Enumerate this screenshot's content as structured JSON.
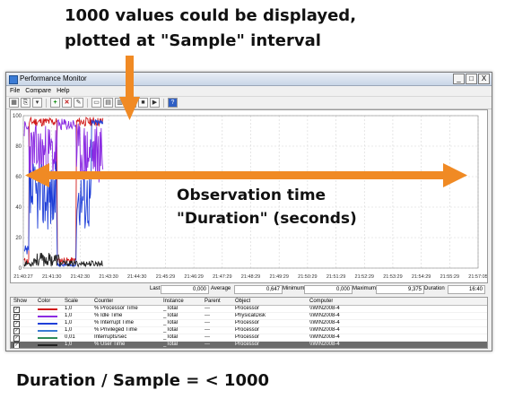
{
  "captions": {
    "top_line1": "1000 values could be displayed,",
    "top_line2": "plotted at \"Sample\" interval",
    "observation_line1": "Observation time",
    "observation_line2": "\"Duration\" (seconds)",
    "bottom": "Duration / Sample =  < 1000"
  },
  "window": {
    "title": "Performance Monitor",
    "buttons": [
      "_",
      "□",
      "X"
    ]
  },
  "menu": [
    "File",
    "Compare",
    "Help"
  ],
  "toolbar_icons": [
    "graph-type-icon",
    "copy-icon",
    "view-icon",
    "add-counter-icon",
    "delete-counter-icon",
    "highlight-icon",
    "copy-properties-icon",
    "paste-icon",
    "properties-icon",
    "zoom-icon",
    "stop-icon",
    "next-icon",
    "help-icon"
  ],
  "graph": {
    "y_ticks": [
      "100",
      "80",
      "60",
      "40",
      "20",
      "0"
    ],
    "x_ticks": [
      "21:40:27",
      "21:41:30",
      "21:42:30",
      "21:43:30",
      "21:44:30",
      "21:45:29",
      "21:46:29",
      "21:47:29",
      "21:48:29",
      "21:49:29",
      "21:50:29",
      "21:51:29",
      "21:52:29",
      "21:53:29",
      "21:54:29",
      "21:55:29",
      "21:57:05"
    ]
  },
  "chart_data": {
    "type": "line",
    "ylim": [
      0,
      100
    ],
    "x": [
      "21:40:27",
      "21:41:30",
      "21:42:30",
      "21:43:30",
      "21:44:30",
      "21:45:29",
      "21:46:29",
      "21:47:29",
      "21:48:29",
      "21:49:29",
      "21:50:29",
      "21:51:29",
      "21:52:29",
      "21:53:29",
      "21:54:29",
      "21:55:29",
      "21:57:05"
    ],
    "grid": true,
    "series": [
      {
        "name": "% Processor Time",
        "color": "#d11a1a",
        "values": [
          2,
          96,
          97,
          96,
          97,
          96
        ]
      },
      {
        "name": "% Idle Time",
        "color": "#8a2be2",
        "values": [
          95,
          4,
          3,
          4,
          3,
          4
        ]
      },
      {
        "name": "% Interrupt Time",
        "color": "#1f3fd8",
        "values": [
          20,
          50,
          35,
          45,
          60,
          96
        ]
      },
      {
        "name": "% Privileged Time",
        "color": "#222222",
        "values": [
          3,
          5,
          4,
          6,
          3,
          2
        ]
      }
    ]
  },
  "stats": {
    "last_label": "Last",
    "last_value": "0,000",
    "average_label": "Average",
    "average_value": "0,647",
    "minimum_label": "Minimum",
    "minimum_value": "0,000",
    "maximum_label": "Maximum",
    "maximum_value": "9,375",
    "duration_label": "Duration",
    "duration_value": "16:40"
  },
  "counters": {
    "headers": [
      "Show",
      "Color",
      "Scale",
      "Counter",
      "Instance",
      "Parent",
      "Object",
      "Computer"
    ],
    "rows": [
      {
        "color": "#d11a1a",
        "scale": "1,0",
        "counter": "% Processor Time",
        "instance": "_Total",
        "parent": "---",
        "object": "Processor",
        "computer": "\\\\WIN2008-4"
      },
      {
        "color": "#8a2be2",
        "scale": "1,0",
        "counter": "% Idle Time",
        "instance": "_Total",
        "parent": "---",
        "object": "PhysicalDisk",
        "computer": "\\\\WIN2008-4"
      },
      {
        "color": "#1f3fd8",
        "scale": "1,0",
        "counter": "% Interrupt Time",
        "instance": "_Total",
        "parent": "---",
        "object": "Processor",
        "computer": "\\\\WIN2008-4"
      },
      {
        "color": "#3a7bd5",
        "scale": "1,0",
        "counter": "% Privileged Time",
        "instance": "_Total",
        "parent": "---",
        "object": "Processor",
        "computer": "\\\\WIN2008-4"
      },
      {
        "color": "#2e8b57",
        "scale": "0,01",
        "counter": "Interrupts/sec",
        "instance": "_Total",
        "parent": "---",
        "object": "Processor",
        "computer": "\\\\WIN2008-4"
      },
      {
        "color": "#222222",
        "scale": "1,0",
        "counter": "% User Time",
        "instance": "_Total",
        "parent": "---",
        "object": "Processor",
        "computer": "\\\\WIN2008-4"
      }
    ]
  }
}
